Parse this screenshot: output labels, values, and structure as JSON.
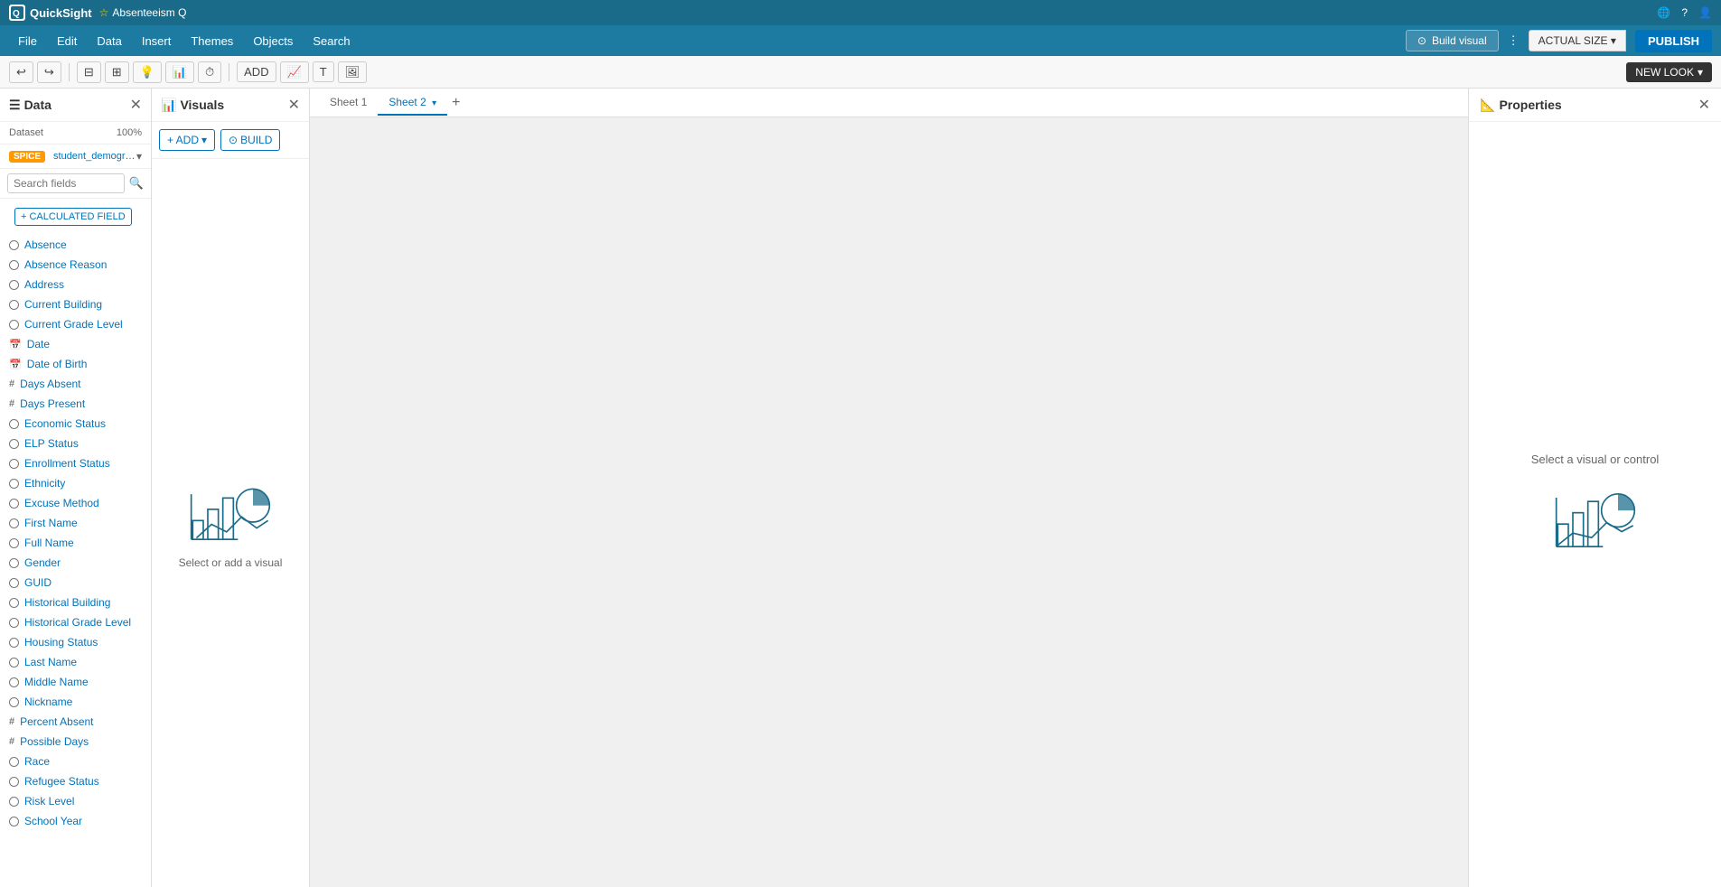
{
  "app": {
    "name": "QuickSight",
    "title": "Absenteeism Q",
    "favicon": "QS"
  },
  "topbar": {
    "icons": [
      "globe-icon",
      "help-icon",
      "user-icon"
    ]
  },
  "menubar": {
    "items": [
      "File",
      "Edit",
      "Data",
      "Insert",
      "Themes",
      "Objects",
      "Search"
    ],
    "build_visual_label": "Build visual",
    "actual_size_label": "ACTUAL SIZE",
    "publish_label": "PUBLISH"
  },
  "toolbar": {
    "undo_label": "←",
    "redo_label": "→",
    "new_look_label": "NEW LOOK",
    "add_label": "ADD"
  },
  "data_panel": {
    "title": "Data",
    "dataset_label": "Dataset",
    "dataset_pct": "100%",
    "spice_label": "SPICE",
    "dataset_name": "student_demograp...",
    "search_placeholder": "Search fields",
    "calculated_field_label": "+ CALCULATED FIELD",
    "fields": [
      {
        "name": "Absence",
        "type": "dim"
      },
      {
        "name": "Absence Reason",
        "type": "dim"
      },
      {
        "name": "Address",
        "type": "dim"
      },
      {
        "name": "Current Building",
        "type": "dim"
      },
      {
        "name": "Current Grade Level",
        "type": "dim"
      },
      {
        "name": "Date",
        "type": "date"
      },
      {
        "name": "Date of Birth",
        "type": "date"
      },
      {
        "name": "Days Absent",
        "type": "num"
      },
      {
        "name": "Days Present",
        "type": "num"
      },
      {
        "name": "Economic Status",
        "type": "dim"
      },
      {
        "name": "ELP Status",
        "type": "dim"
      },
      {
        "name": "Enrollment Status",
        "type": "dim"
      },
      {
        "name": "Ethnicity",
        "type": "dim"
      },
      {
        "name": "Excuse Method",
        "type": "dim"
      },
      {
        "name": "First Name",
        "type": "dim"
      },
      {
        "name": "Full Name",
        "type": "dim"
      },
      {
        "name": "Gender",
        "type": "dim"
      },
      {
        "name": "GUID",
        "type": "dim"
      },
      {
        "name": "Historical Building",
        "type": "dim"
      },
      {
        "name": "Historical Grade Level",
        "type": "dim"
      },
      {
        "name": "Housing Status",
        "type": "dim"
      },
      {
        "name": "Last Name",
        "type": "dim"
      },
      {
        "name": "Middle Name",
        "type": "dim"
      },
      {
        "name": "Nickname",
        "type": "dim"
      },
      {
        "name": "Percent Absent",
        "type": "num"
      },
      {
        "name": "Possible Days",
        "type": "num"
      },
      {
        "name": "Race",
        "type": "dim"
      },
      {
        "name": "Refugee Status",
        "type": "dim"
      },
      {
        "name": "Risk Level",
        "type": "dim"
      },
      {
        "name": "School Year",
        "type": "dim"
      }
    ]
  },
  "visuals_panel": {
    "title": "Visuals",
    "add_label": "+ ADD",
    "build_label": "BUILD",
    "placeholder_text": "Select or add a visual"
  },
  "sheets": {
    "tabs": [
      "Sheet 1",
      "Sheet 2"
    ],
    "active": "Sheet 2"
  },
  "properties_panel": {
    "title": "Properties",
    "placeholder_text": "Select a visual or control"
  }
}
